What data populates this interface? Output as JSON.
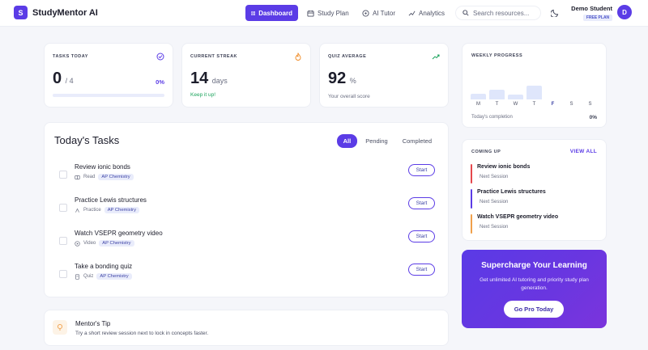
{
  "nav": {
    "logo_letter": "S",
    "brand": "StudyMentor AI",
    "items": [
      {
        "label": "Dashboard",
        "icon": "grid-icon"
      },
      {
        "label": "Study Plan",
        "icon": "calendar-icon"
      },
      {
        "label": "AI Tutor",
        "icon": "chat-bubble-icon"
      },
      {
        "label": "Analytics",
        "icon": "trend-icon"
      }
    ],
    "search_placeholder": "Search resources...",
    "user_name": "Demo Student",
    "plan": "FREE PLAN",
    "avatar_letter": "D"
  },
  "stats": {
    "tasks_today": {
      "label": "TASKS TODAY",
      "done": "0",
      "total": "/ 4",
      "percent": "0%",
      "progress": 0
    },
    "streak": {
      "label": "CURRENT STREAK",
      "value": "14",
      "unit": "days",
      "note": "Keep it up!"
    },
    "quiz": {
      "label": "QUIZ AVERAGE",
      "value": "92",
      "unit": "%",
      "note": "Your overall score"
    }
  },
  "tasks": {
    "title": "Today's Tasks",
    "tabs": [
      "All",
      "Pending",
      "Completed"
    ],
    "start_label": "Start",
    "items": [
      {
        "title": "Review ionic bonds",
        "type": "Read",
        "subject": "AP Chemistry"
      },
      {
        "title": "Practice Lewis structures",
        "type": "Practice",
        "subject": "AP Chemistry"
      },
      {
        "title": "Watch VSEPR geometry video",
        "type": "Video",
        "subject": "AP Chemistry"
      },
      {
        "title": "Take a bonding quiz",
        "type": "Quiz",
        "subject": "AP Chemistry"
      }
    ]
  },
  "tip": {
    "title": "Mentor's Tip",
    "text": "Try a short review session next to lock in concepts faster."
  },
  "weekly": {
    "label": "WEEKLY PROGRESS",
    "days": [
      "M",
      "T",
      "W",
      "T",
      "F",
      "S",
      "S"
    ],
    "levels": [
      0.25,
      0.4,
      0.2,
      0.6,
      0,
      0,
      0
    ],
    "today_index": 4,
    "footer": "Today's completion",
    "percent": "0%"
  },
  "coming_up": {
    "label": "COMING UP",
    "view_all": "VIEW ALL",
    "items": [
      {
        "title": "Review ionic bonds",
        "sub": "Next Session",
        "color": "#e5484d"
      },
      {
        "title": "Practice Lewis structures",
        "sub": "Next Session",
        "color": "#5b3ce6"
      },
      {
        "title": "Watch VSEPR geometry video",
        "sub": "Next Session",
        "color": "#f0a04b"
      }
    ]
  },
  "promo": {
    "title": "Supercharge Your Learning",
    "text": "Get unlimited AI tutoring and priority study plan generation.",
    "button": "Go Pro Today"
  },
  "colors": {
    "accent": "#5b3ce6",
    "success": "#1aa35b",
    "streak": "#f08a24"
  }
}
